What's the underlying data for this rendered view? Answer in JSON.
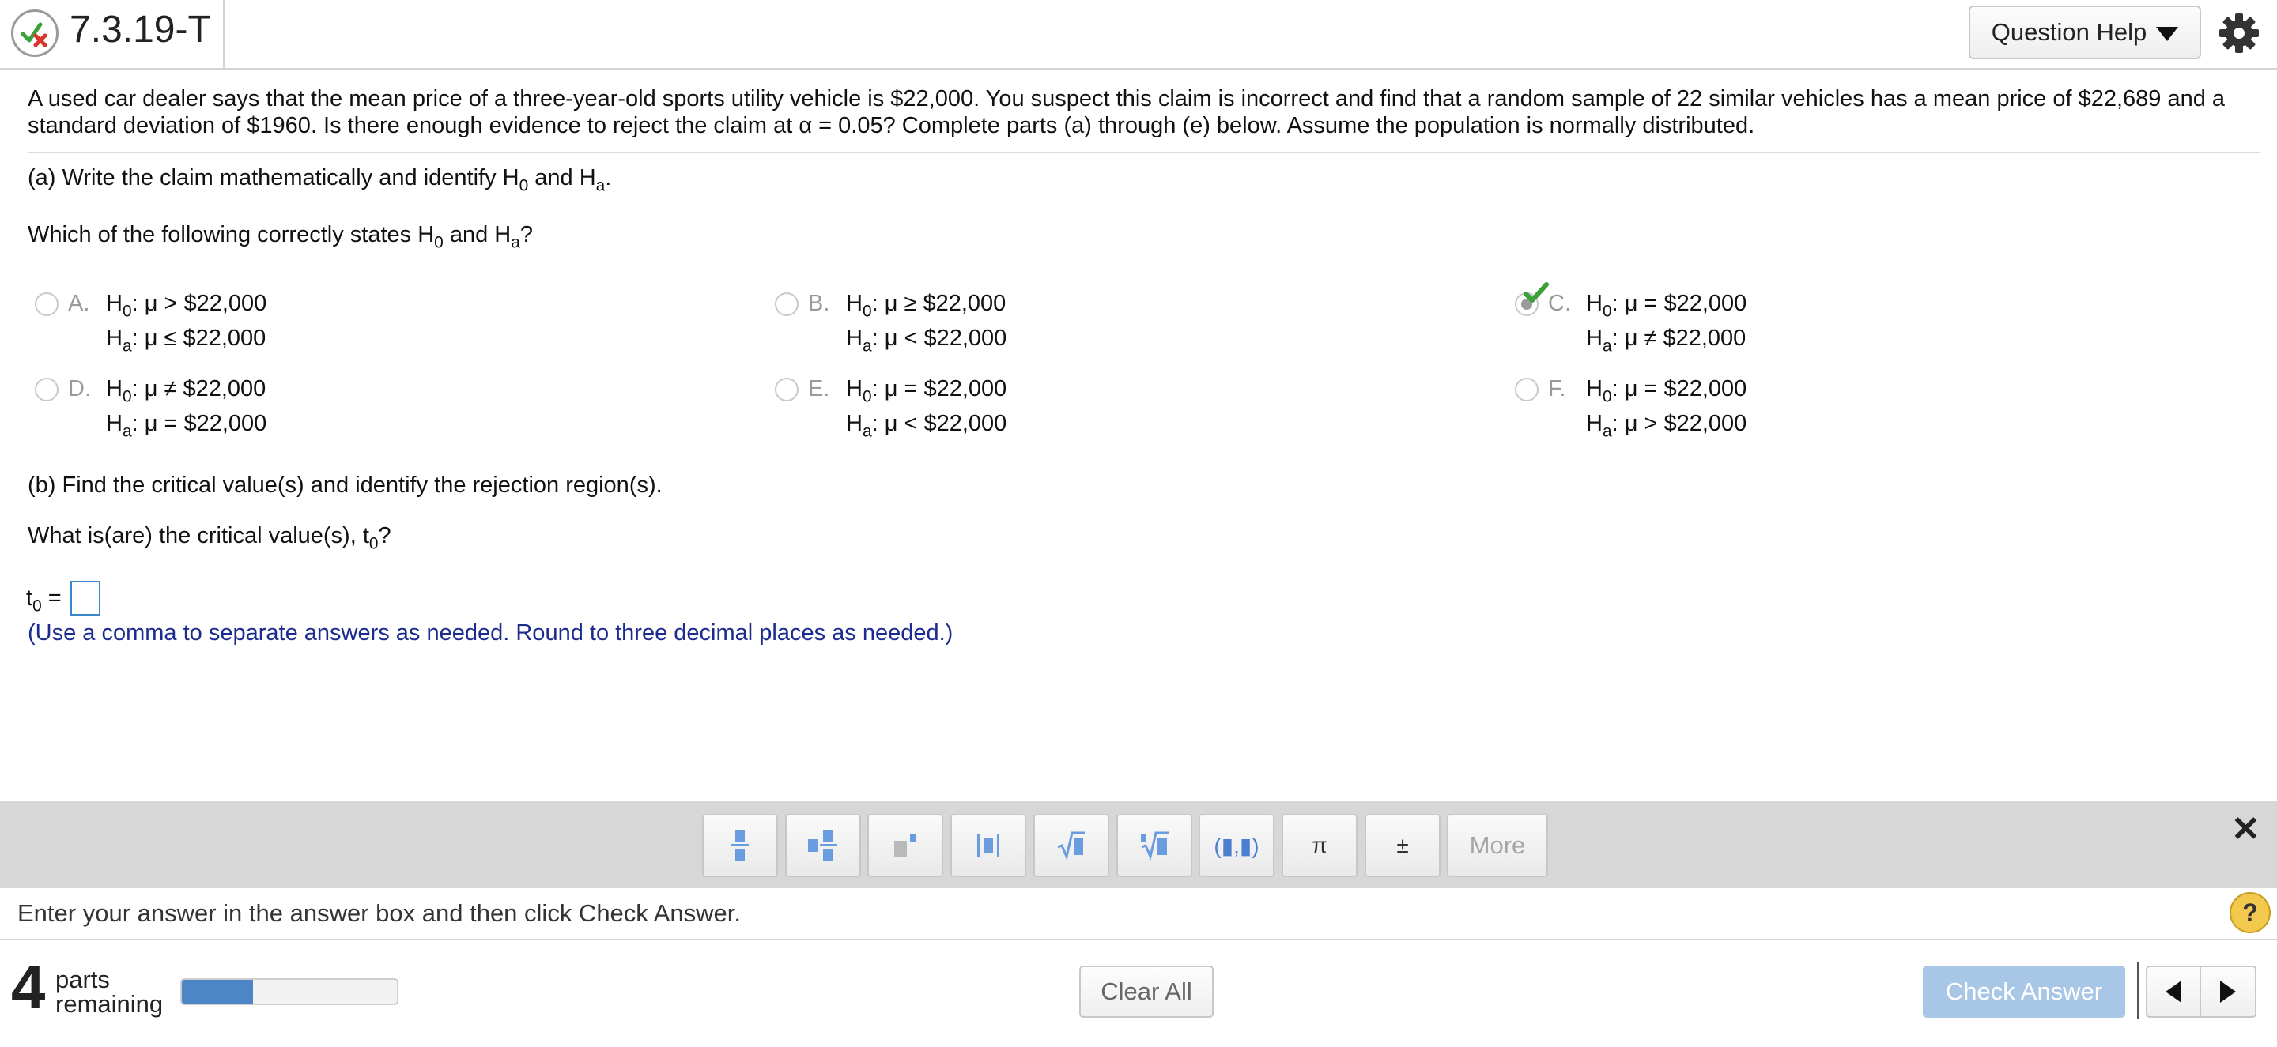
{
  "header": {
    "question_id": "7.3.19-T",
    "help_label": "Question Help"
  },
  "problem": {
    "text": "A used car dealer says that the mean price of a three-year-old sports utility vehicle is $22,000. You suspect this claim is incorrect and find that a random sample of 22 similar vehicles has a mean price of $22,689 and a standard deviation of $1960. Is there enough evidence to reject the claim at α = 0.05? Complete parts (a) through (e) below. Assume the population is normally distributed."
  },
  "part_a": {
    "prompt_prefix": "(a) Write the claim mathematically and identify H",
    "h0_sub": "0",
    "and": " and H",
    "ha_sub": "a",
    "prompt_suffix": ".",
    "question_prefix": "Which of the following correctly states H",
    "question_suffix": "?",
    "options": [
      {
        "letter": "A.",
        "h0": "μ > $22,000",
        "ha": "μ ≤ $22,000"
      },
      {
        "letter": "B.",
        "h0": "μ ≥ $22,000",
        "ha": "μ < $22,000"
      },
      {
        "letter": "C.",
        "h0": "μ = $22,000",
        "ha": "μ ≠ $22,000"
      },
      {
        "letter": "D.",
        "h0": "μ ≠ $22,000",
        "ha": "μ = $22,000"
      },
      {
        "letter": "E.",
        "h0": "μ = $22,000",
        "ha": "μ < $22,000"
      },
      {
        "letter": "F.",
        "h0": "μ = $22,000",
        "ha": "μ > $22,000"
      }
    ],
    "selected": "C"
  },
  "part_b": {
    "prompt": "(b) Find the critical value(s) and identify the rejection region(s).",
    "question_prefix": "What is(are) the critical value(s), t",
    "question_sub": "0",
    "question_suffix": "?",
    "answer_label": "t",
    "answer_sub": "0",
    "answer_eq": " =",
    "answer_value": "",
    "hint": "(Use a comma to separate answers as needed. Round to three decimal places as needed.)"
  },
  "toolbar": {
    "tools": [
      "fraction-icon",
      "mixed-number-icon",
      "exponent-icon",
      "absolute-value-icon",
      "square-root-icon",
      "nth-root-icon",
      "ordered-pair-icon",
      "pi-icon",
      "plus-minus-icon"
    ],
    "pi": "π",
    "plus_minus": "±",
    "ordered_pair": "(▮,▮)",
    "more_label": "More",
    "close": "✕"
  },
  "instruction": {
    "text": "Enter your answer in the answer box and then click Check Answer.",
    "help": "?"
  },
  "footer": {
    "parts_count": "4",
    "parts_line1": "parts",
    "parts_line2": "remaining",
    "progress_fraction": 0.33,
    "clear_label": "Clear All",
    "check_label": "Check Answer"
  },
  "colors": {
    "accent_blue": "#4d86c6",
    "check_green": "#3aa13a",
    "wrong_red": "#d9342b",
    "hint_navy": "#1b2b8f"
  }
}
